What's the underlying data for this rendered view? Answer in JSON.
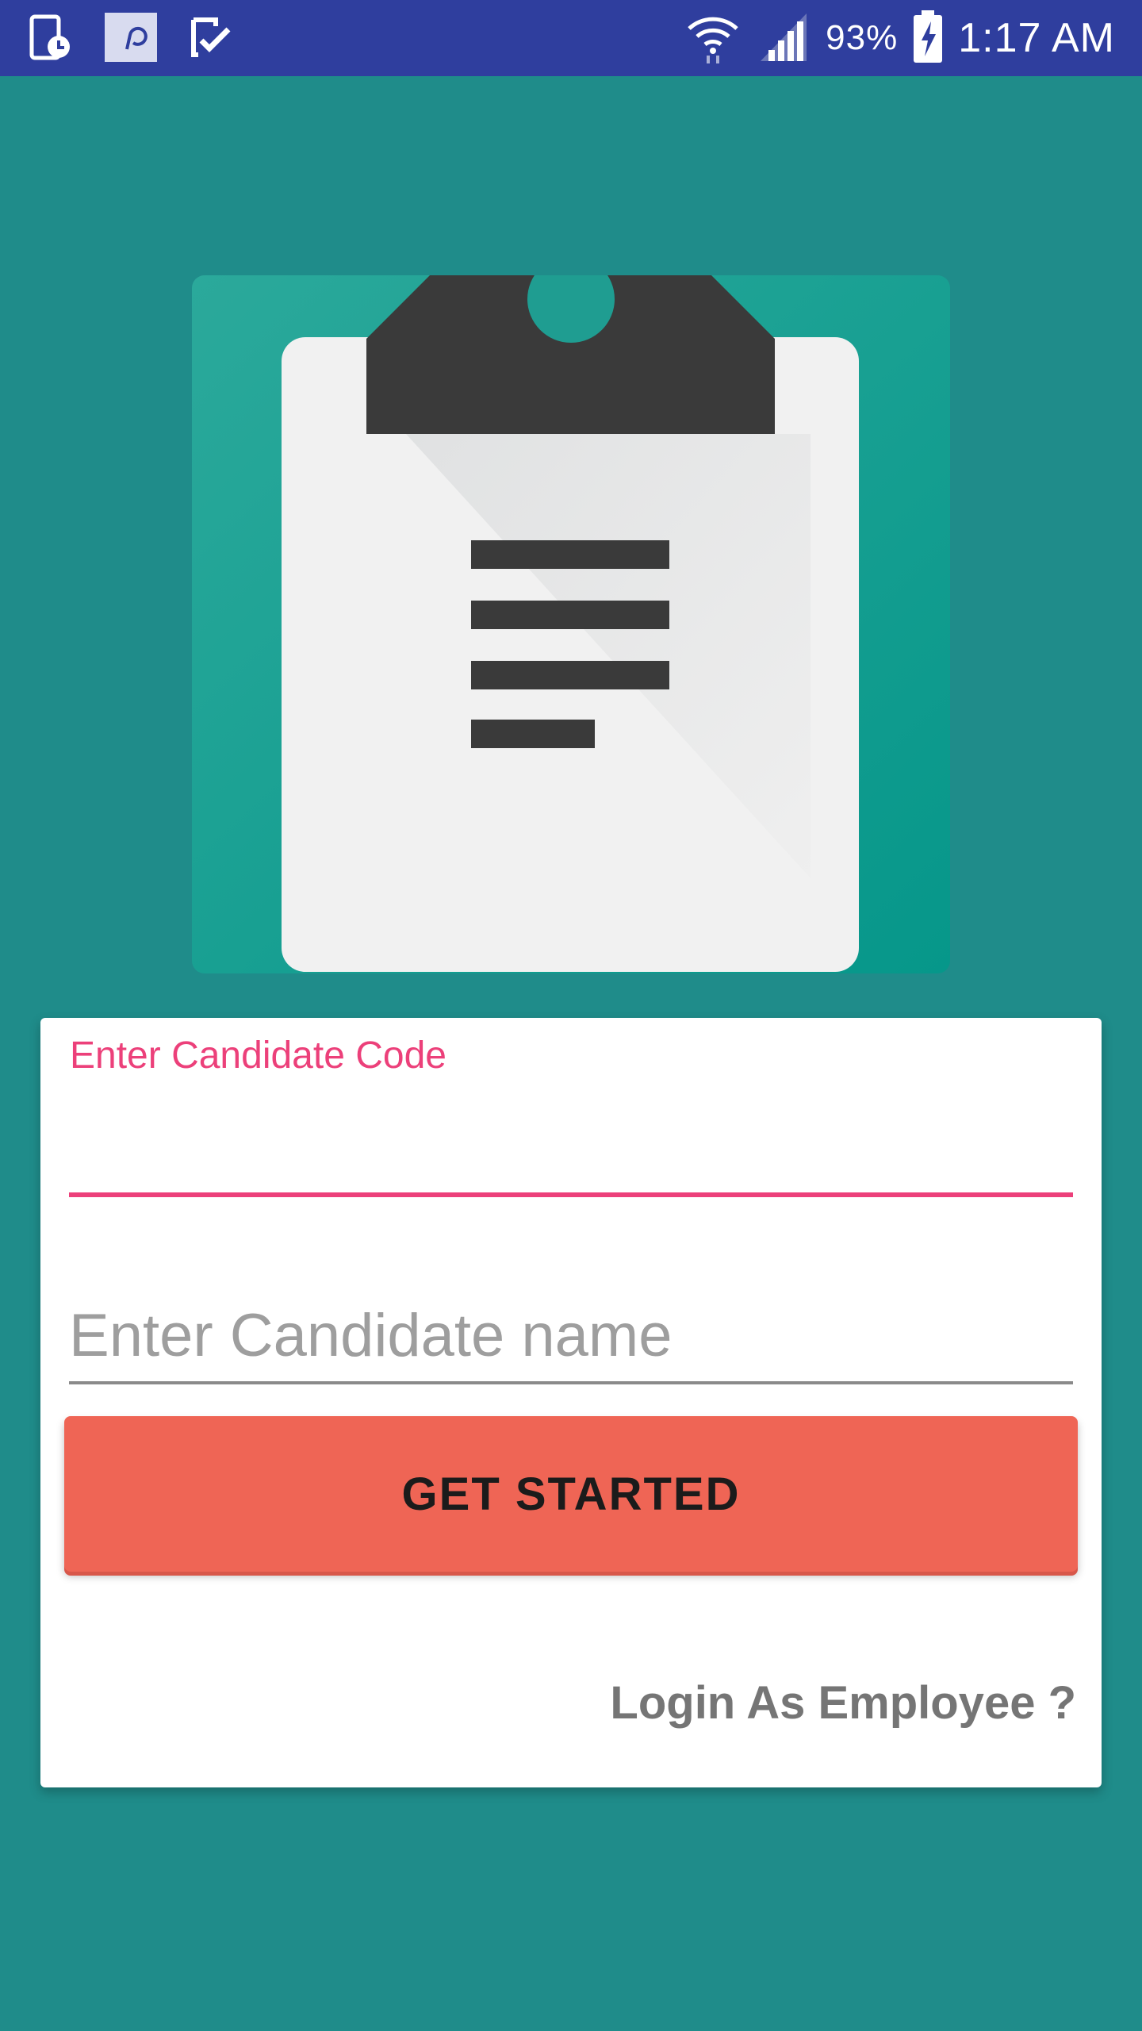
{
  "status_bar": {
    "battery_percent": "93%",
    "time": "1:17 AM",
    "icons": [
      "screenshot-timer-icon",
      "pinterest-like-icon",
      "check-tasks-icon",
      "wifi-icon",
      "signal-icon",
      "battery-charging-icon"
    ]
  },
  "form": {
    "code_label": "Enter Candidate Code",
    "code_value": "",
    "name_placeholder": "Enter Candidate name",
    "name_value": "",
    "submit_label": "GET STARTED",
    "login_link": "Login As Employee ?"
  },
  "colors": {
    "background": "#1f8c8a",
    "status_bar": "#2f3e9e",
    "accent_pink": "#ec407a",
    "button": "#ef6555"
  }
}
